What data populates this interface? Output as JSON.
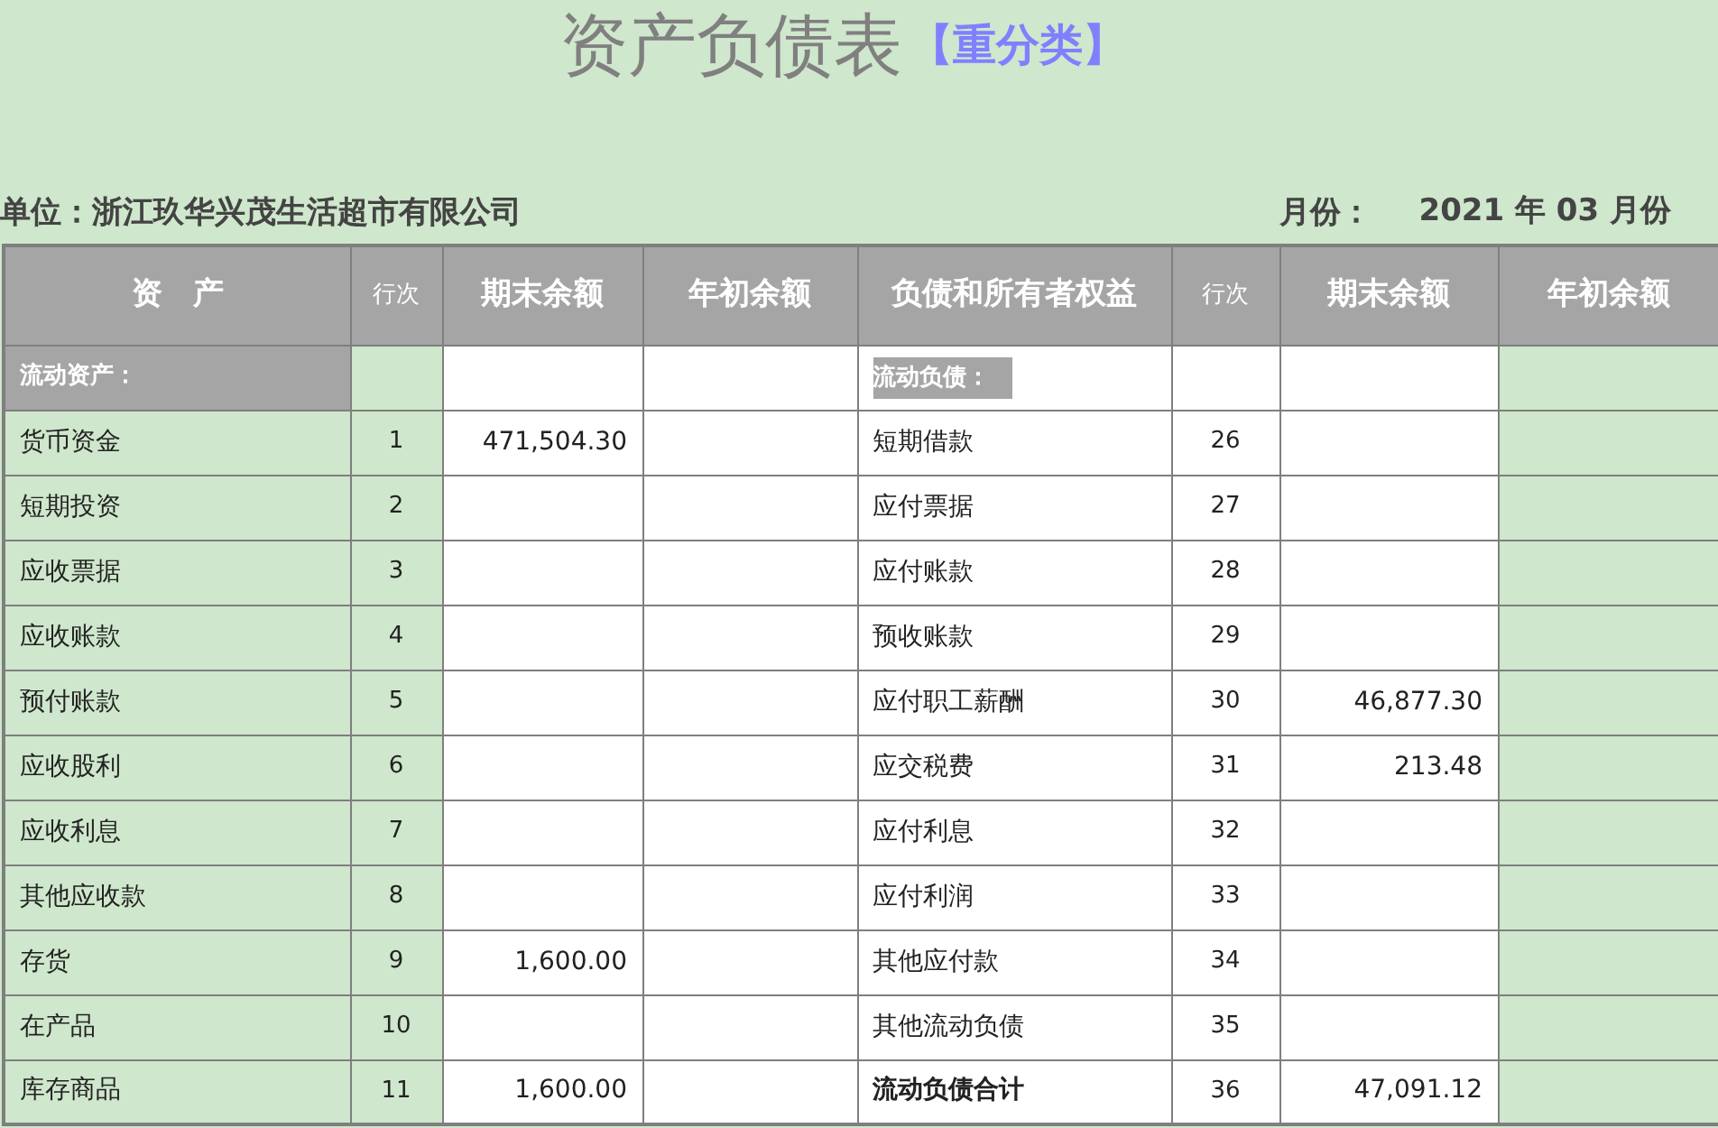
{
  "title": "资产负债表",
  "subtitle": "【重分类】",
  "unit": {
    "label": "单位：",
    "value": "浙江玖华兴茂生活超市有限公司"
  },
  "period": {
    "label": "月份：",
    "year": "2021",
    "year_unit": "年",
    "month": "03",
    "month_unit": "月份"
  },
  "columns": [
    "资　产",
    "行次",
    "期末余额",
    "年初余额",
    "负债和所有者权益",
    "行次",
    "期末余额",
    "年初余额"
  ],
  "rows": [
    {
      "kind": "section",
      "asset": {
        "label": "流动资产："
      },
      "liability": {
        "label": "流动负债："
      }
    },
    {
      "kind": "item",
      "asset": {
        "label": "货币资金",
        "no": "1",
        "end": "471,504.30"
      },
      "liability": {
        "label": "短期借款",
        "no": "26",
        "bold": false
      }
    },
    {
      "kind": "item",
      "asset": {
        "label": "短期投资",
        "no": "2"
      },
      "liability": {
        "label": "应付票据",
        "no": "27",
        "bold": false
      }
    },
    {
      "kind": "item",
      "asset": {
        "label": "应收票据",
        "no": "3"
      },
      "liability": {
        "label": "应付账款",
        "no": "28",
        "bold": false
      }
    },
    {
      "kind": "item",
      "asset": {
        "label": "应收账款",
        "no": "4"
      },
      "liability": {
        "label": "预收账款",
        "no": "29",
        "bold": false
      }
    },
    {
      "kind": "item",
      "asset": {
        "label": "预付账款",
        "no": "5"
      },
      "liability": {
        "label": "应付职工薪酬",
        "no": "30",
        "end": "46,877.30",
        "bold": false
      }
    },
    {
      "kind": "item",
      "asset": {
        "label": "应收股利",
        "no": "6"
      },
      "liability": {
        "label": "应交税费",
        "no": "31",
        "end": "213.48",
        "bold": false
      }
    },
    {
      "kind": "item",
      "asset": {
        "label": "应收利息",
        "no": "7"
      },
      "liability": {
        "label": "应付利息",
        "no": "32",
        "bold": false
      }
    },
    {
      "kind": "item",
      "asset": {
        "label": "其他应收款",
        "no": "8"
      },
      "liability": {
        "label": "应付利润",
        "no": "33",
        "bold": false
      }
    },
    {
      "kind": "item",
      "asset": {
        "label": "存货",
        "no": "9",
        "end": "1,600.00"
      },
      "liability": {
        "label": "其他应付款",
        "no": "34",
        "bold": false
      }
    },
    {
      "kind": "item",
      "asset": {
        "label": "在产品",
        "no": "10"
      },
      "liability": {
        "label": "其他流动负债",
        "no": "35",
        "bold": false
      }
    },
    {
      "kind": "item",
      "asset": {
        "label": "库存商品",
        "no": "11",
        "end": "1,600.00"
      },
      "liability": {
        "label": "流动负债合计",
        "no": "36",
        "end": "47,091.12",
        "bold": true
      }
    }
  ]
}
